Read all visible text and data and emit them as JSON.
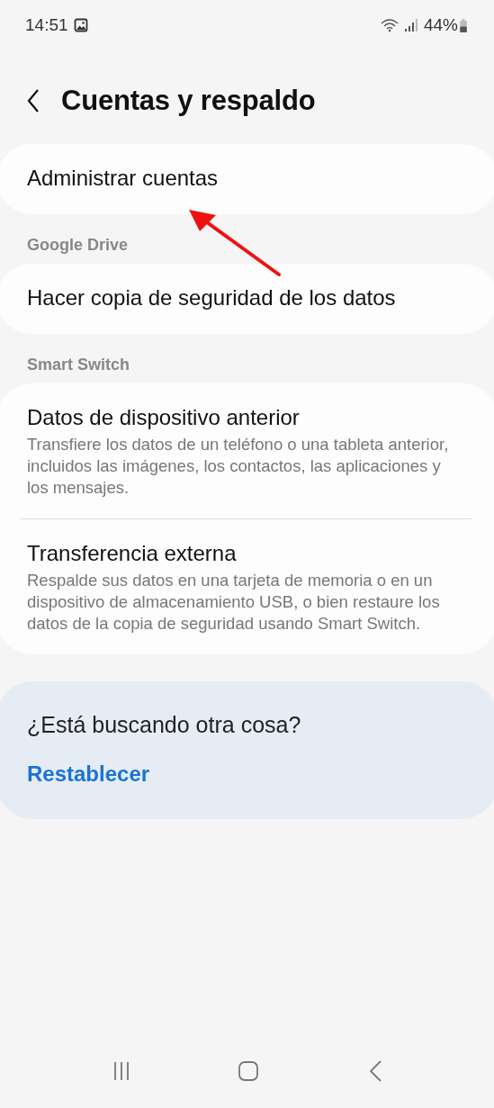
{
  "status_bar": {
    "time": "14:51",
    "battery": "44%"
  },
  "header": {
    "title": "Cuentas y respaldo"
  },
  "sections": [
    {
      "items": [
        {
          "title": "Administrar cuentas"
        }
      ]
    },
    {
      "heading": "Google Drive",
      "items": [
        {
          "title": "Hacer copia de seguridad de los datos"
        }
      ]
    },
    {
      "heading": "Smart Switch",
      "items": [
        {
          "title": "Datos de dispositivo anterior",
          "summary": "Transfiere los datos de un teléfono o una tableta anterior, incluidos las imágenes, los contactos, las aplicaciones y los mensajes."
        },
        {
          "title": "Transferencia externa",
          "summary": "Respalde sus datos en una tarjeta de memoria o en un dispositivo de almacenamiento USB, o bien restaure los datos de la copia de seguridad usando Smart Switch."
        }
      ]
    }
  ],
  "suggestion": {
    "question": "¿Está buscando otra cosa?",
    "link": "Restablecer"
  }
}
